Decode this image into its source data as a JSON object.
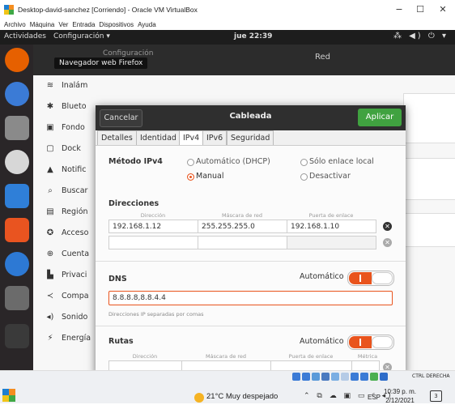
{
  "window": {
    "title": "Desktop-david-sanchez [Corriendo] - Oracle VM VirtualBox",
    "controls": {
      "minimize": "−",
      "maximize": "☐",
      "close": "✕"
    },
    "menu": [
      "Archivo",
      "Máquina",
      "Ver",
      "Entrada",
      "Dispositivos",
      "Ayuda"
    ]
  },
  "topbar": {
    "activities": "Actividades",
    "app_menu": "Configuración ▾",
    "clock": "jue 22:39",
    "system": "⁂ ◀) ⏻ ▾"
  },
  "settings": {
    "header_title": "Configuración",
    "section_title": "Red",
    "tooltip": "Navegador web Firefox",
    "sidebar": [
      {
        "icon": "wifi-icon",
        "glyph": "≋",
        "label": "Inalám"
      },
      {
        "icon": "bluetooth-icon",
        "glyph": "✱",
        "label": "Blueto"
      },
      {
        "icon": "background-icon",
        "glyph": "▣",
        "label": "Fondo"
      },
      {
        "icon": "dock-icon",
        "glyph": "▢",
        "label": "Dock"
      },
      {
        "icon": "notifications-icon",
        "glyph": "▲",
        "label": "Notific"
      },
      {
        "icon": "search-icon",
        "glyph": "⌕",
        "label": "Buscar"
      },
      {
        "icon": "region-icon",
        "glyph": "▤",
        "label": "Región"
      },
      {
        "icon": "accessibility-icon",
        "glyph": "✪",
        "label": "Acceso"
      },
      {
        "icon": "accounts-icon",
        "glyph": "⊕",
        "label": "Cuenta"
      },
      {
        "icon": "privacy-icon",
        "glyph": "▙",
        "label": "Privaci"
      },
      {
        "icon": "share-icon",
        "glyph": "≺",
        "label": "Compa"
      },
      {
        "icon": "sound-icon",
        "glyph": "◂)",
        "label": "Sonido"
      },
      {
        "icon": "power-icon",
        "glyph": "⚡",
        "label": "Energía"
      }
    ]
  },
  "dialog": {
    "cancel": "Cancelar",
    "title": "Cableada",
    "apply": "Aplicar",
    "tabs": [
      "Detalles",
      "Identidad",
      "IPv4",
      "IPv6",
      "Seguridad"
    ],
    "active_tab": "IPv4",
    "ipv4_method_label": "Método IPv4",
    "methods": [
      {
        "label": "Automático (DHCP)",
        "selected": false
      },
      {
        "label": "Sólo enlace local",
        "selected": false
      },
      {
        "label": "Manual",
        "selected": true
      },
      {
        "label": "Desactivar",
        "selected": false
      }
    ],
    "addresses": {
      "title": "Direcciones",
      "columns": [
        "Dirección",
        "Máscara de red",
        "Puerta de enlace"
      ],
      "rows": [
        {
          "address": "192.168.1.12",
          "netmask": "255.255.255.0",
          "gateway": "192.168.1.10"
        },
        {
          "address": "",
          "netmask": "",
          "gateway": ""
        }
      ]
    },
    "dns": {
      "title": "DNS",
      "auto_label": "Automático",
      "auto_on": true,
      "value": "8.8.8.8,8.8.4.4",
      "hint": "Direcciones IP separadas por comas"
    },
    "routes": {
      "title": "Rutas",
      "auto_label": "Automático",
      "auto_on": true,
      "columns": [
        "Dirección",
        "Máscara de red",
        "Puerta de enlace",
        "Métrica"
      ]
    }
  },
  "taskbar": {
    "host_key": "CTRL DERECHA",
    "weather": "21°C  Muy despejado",
    "tray": "⌃ ⧉ ☁ ▣ ▭ ◜ ◂)",
    "language": "ESP",
    "time": "10:39 p. m.",
    "date": "2/12/2021",
    "notifications": "3"
  }
}
